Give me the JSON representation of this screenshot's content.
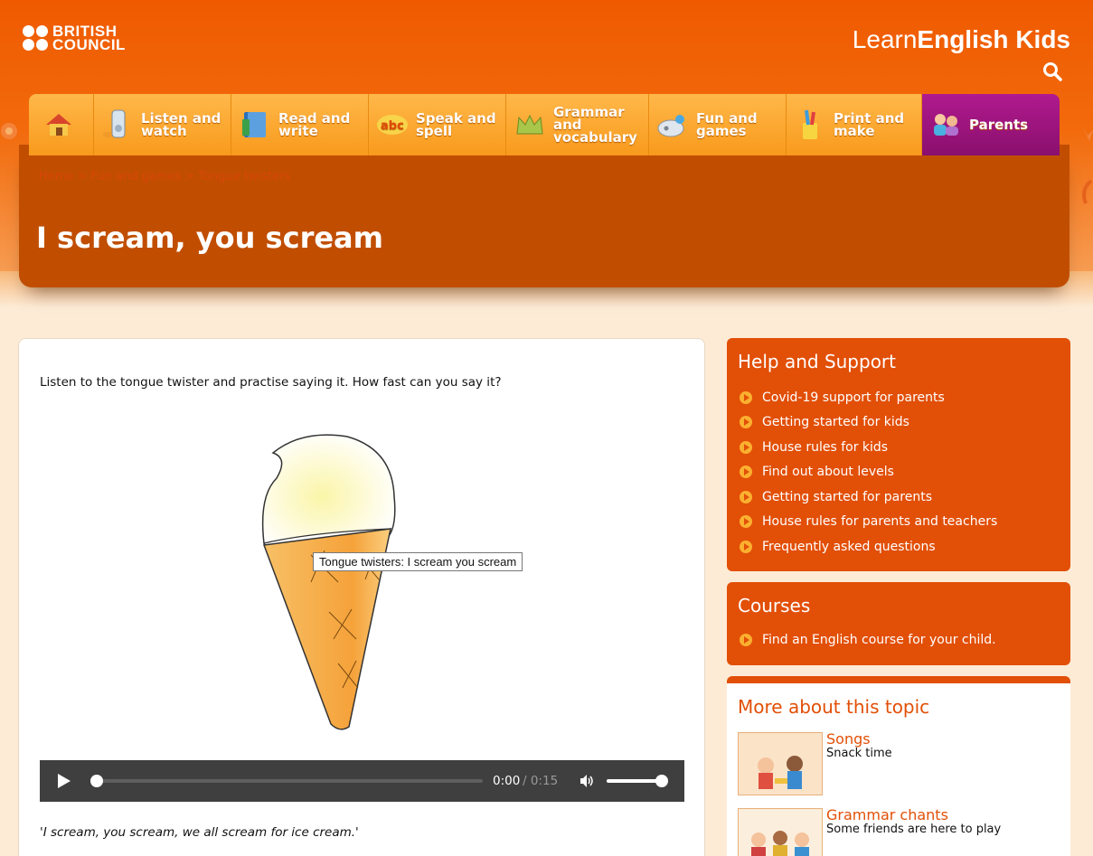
{
  "header": {
    "logo_line1": "BRITISH",
    "logo_line2": "COUNCIL",
    "site_name_light": "Learn",
    "site_name_bold": "English Kids",
    "brand_color": "#ef5a00"
  },
  "nav": {
    "items": [
      {
        "label": "",
        "icon": "home-icon"
      },
      {
        "label": "Listen and watch",
        "icon": "mp3-player-icon"
      },
      {
        "label": "Read and write",
        "icon": "book-icon"
      },
      {
        "label": "Speak and spell",
        "icon": "abc-speech-icon"
      },
      {
        "label": "Grammar and vocabulary",
        "icon": "crown-icon"
      },
      {
        "label": "Fun and games",
        "icon": "gamepad-icon"
      },
      {
        "label": "Print and make",
        "icon": "pencil-cup-icon"
      },
      {
        "label": "Parents",
        "icon": "parents-icon"
      }
    ]
  },
  "banner": {
    "breadcrumb": "Home > Fun and games > Tongue twisters",
    "title": "I scream, you scream"
  },
  "main": {
    "intro": "Listen to the tongue twister and practise saying it. How fast can you say it?",
    "video_tooltip": "Tongue twisters: I scream you scream",
    "player": {
      "current_time": "0:00",
      "duration": "/ 0:15",
      "progress": 0,
      "volume": 1
    },
    "quote": "'I scream, you scream, we all scream for ice cream.'"
  },
  "sidebar": {
    "help": {
      "title": "Help and Support",
      "links": [
        "Covid-19 support for parents",
        "Getting started for kids",
        "House rules for kids",
        "Find out about levels",
        "Getting started for parents",
        "House rules for parents and teachers",
        "Frequently asked questions"
      ]
    },
    "courses": {
      "title": "Courses",
      "links": [
        "Find an English course for your child."
      ]
    },
    "more": {
      "title": "More about this topic",
      "topics": [
        {
          "title": "Songs",
          "subtitle": "Snack time"
        },
        {
          "title": "Grammar chants",
          "subtitle": "Some friends are here to play"
        }
      ]
    }
  }
}
